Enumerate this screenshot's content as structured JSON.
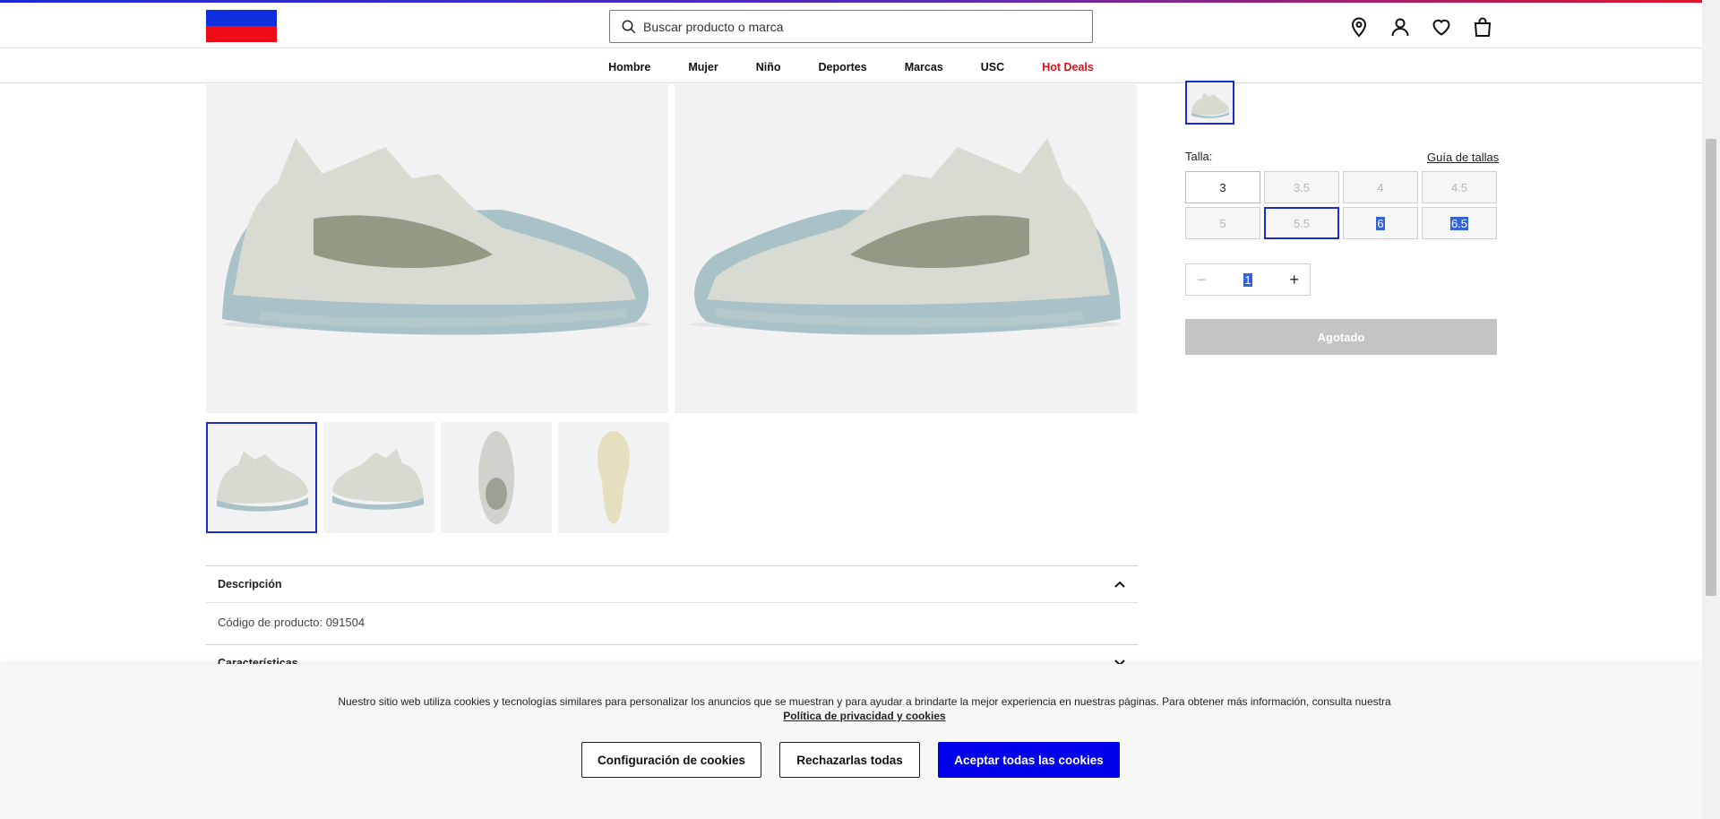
{
  "header": {
    "search_placeholder": "Buscar producto o marca",
    "icons": [
      "location-pin-icon",
      "user-icon",
      "heart-icon",
      "bag-icon"
    ]
  },
  "nav": {
    "items": [
      "Hombre",
      "Mujer",
      "Niño",
      "Deportes",
      "Marcas",
      "USC",
      "Hot Deals"
    ]
  },
  "product": {
    "talla_label": "Talla:",
    "size_guide": "Guía de tallas",
    "sizes": [
      "3",
      "3.5",
      "4",
      "4.5",
      "5",
      "5.5",
      "6",
      "6.5"
    ],
    "quantity": "1",
    "button_label": "Agotado"
  },
  "accordions": {
    "description_title": "Descripción",
    "description_body": "Código de producto: 091504",
    "features_title": "Características"
  },
  "cookie_banner": {
    "text": "Nuestro sitio web utiliza cookies y tecnologías similares para personalizar los anuncios que se muestran y para ayudar a brindarte la mejor experiencia en nuestras páginas. Para obtener más información, consulta nuestra",
    "policy_link": "Política de privacidad y cookies",
    "config_button": "Configuración de cookies",
    "reject_button": "Rechazarlas todas",
    "accept_button": "Aceptar todas las cookies"
  },
  "colors": {
    "brand_blue": "#0f2ee0",
    "brand_red": "#ee0a16",
    "accent": "#0000ea",
    "hot_deals": "#e0101b"
  }
}
